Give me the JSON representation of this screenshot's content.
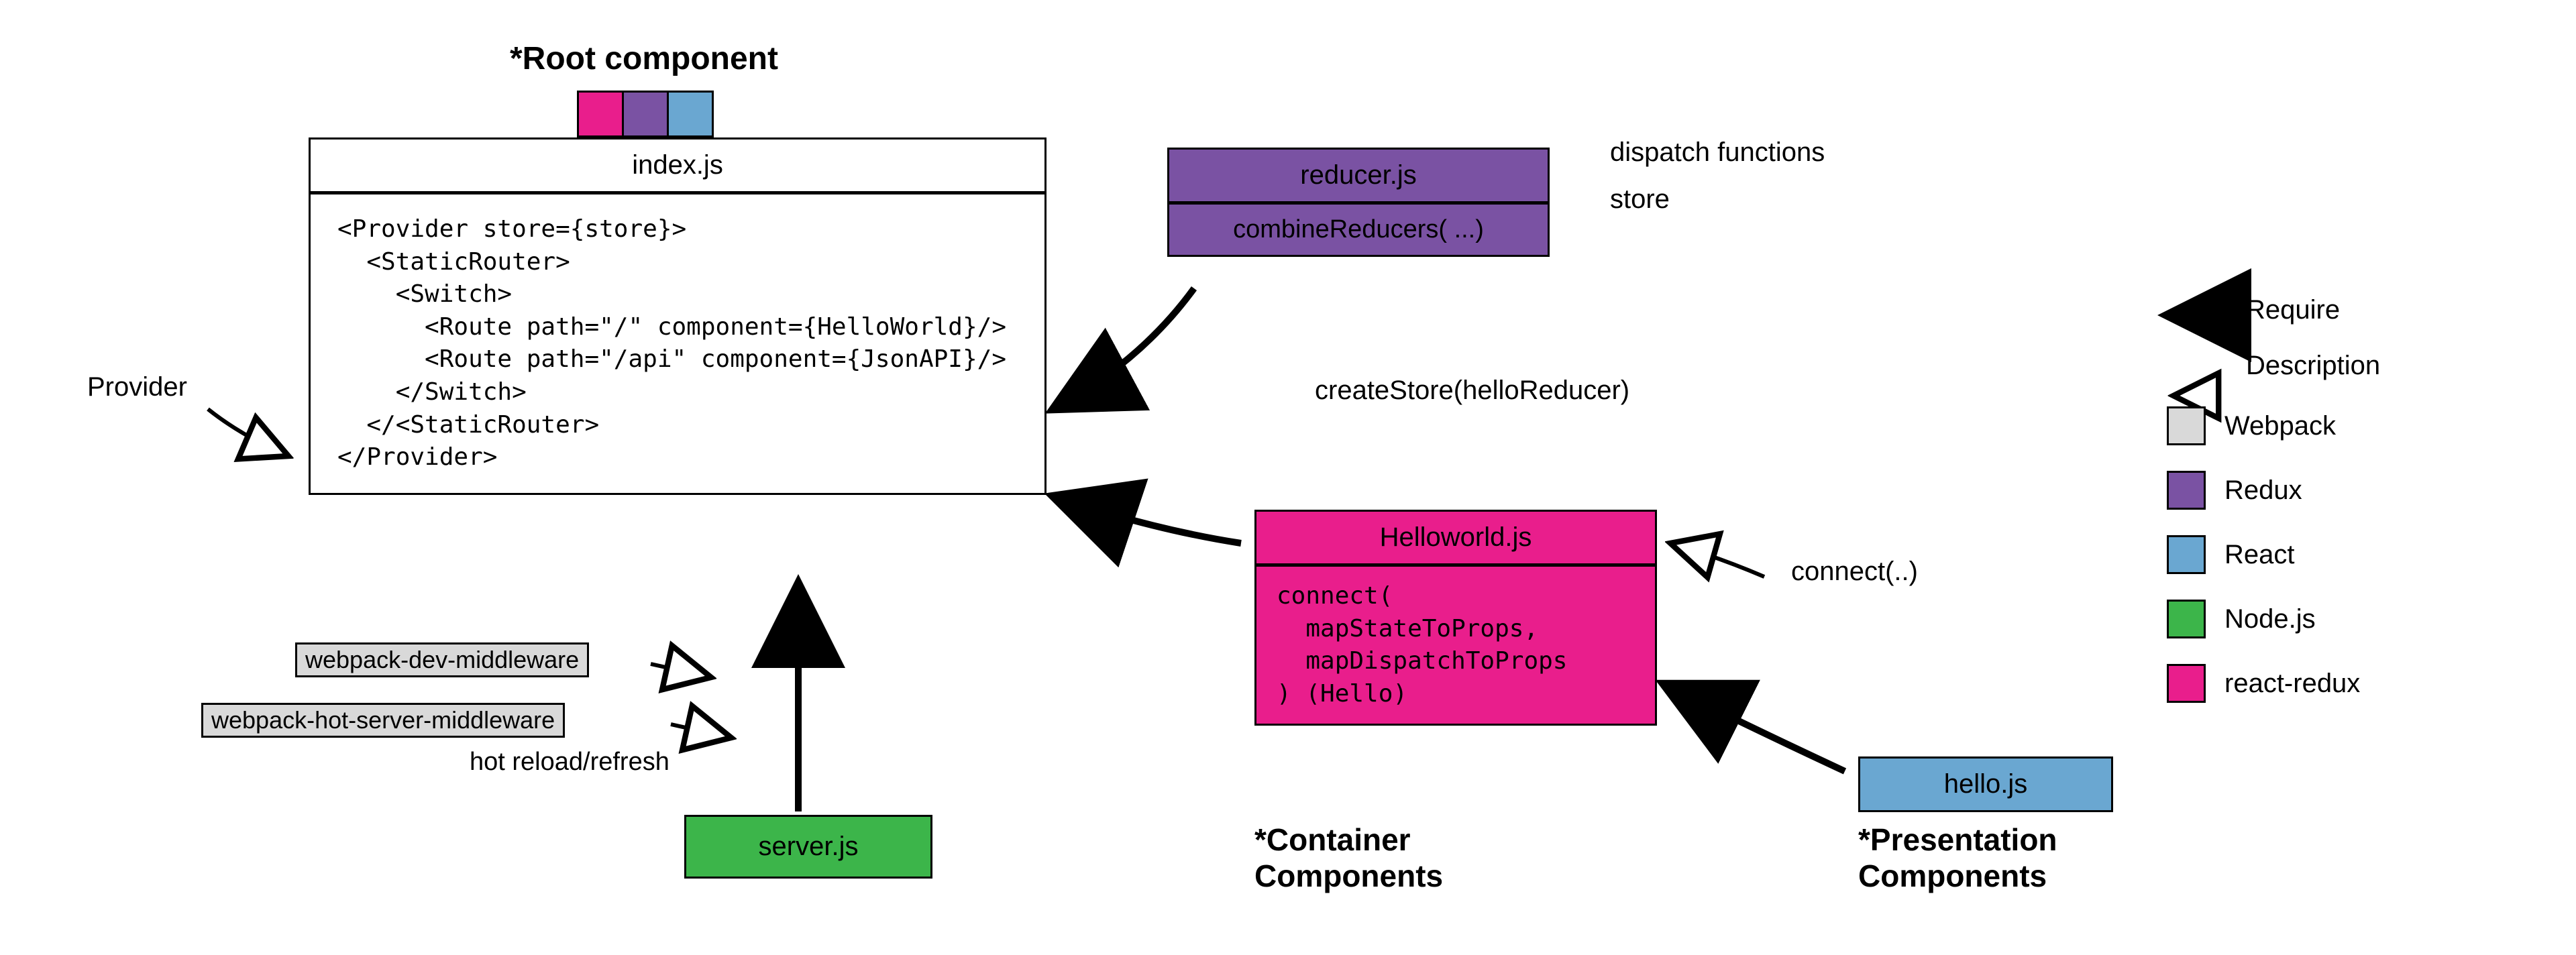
{
  "headings": {
    "root": "*Root component",
    "container": "*Container\nComponents",
    "presentation": "*Presentation\nComponents"
  },
  "index_box": {
    "title": "index.js",
    "code": "<Provider store={store}>\n  <StaticRouter>\n    <Switch>\n      <Route path=\"/\" component={HelloWorld}/>\n      <Route path=\"/api\" component={JsonAPI}/>\n    </Switch>\n  </<StaticRouter>\n</Provider>"
  },
  "reducer_box": {
    "title": "reducer.js",
    "body": "combineReducers( ...)"
  },
  "helloworld_box": {
    "title": "Helloworld.js",
    "body": "connect(\n  mapStateToProps,\n  mapDispatchToProps\n) (Hello)"
  },
  "hello_box": {
    "title": "hello.js"
  },
  "server_box": {
    "title": "server.js"
  },
  "middleware": {
    "dev": "webpack-dev-middleware",
    "hot": "webpack-hot-server-middleware",
    "note": "hot reload/refresh"
  },
  "labels": {
    "provider": "Provider",
    "dispatch": "dispatch functions",
    "store": "store",
    "createStore": "createStore(helloReducer)",
    "connect": "connect(..)"
  },
  "legend": {
    "require": "Require",
    "description": "Description",
    "webpack": "Webpack",
    "redux": "Redux",
    "react": "React",
    "node": "Node.js",
    "reactredux": "react-redux"
  },
  "colors": {
    "webpack": "#d9d9d9",
    "redux": "#7a52a3",
    "react": "#6aa7d1",
    "node": "#3cb54a",
    "reactredux": "#e91e8c",
    "white": "#ffffff"
  }
}
